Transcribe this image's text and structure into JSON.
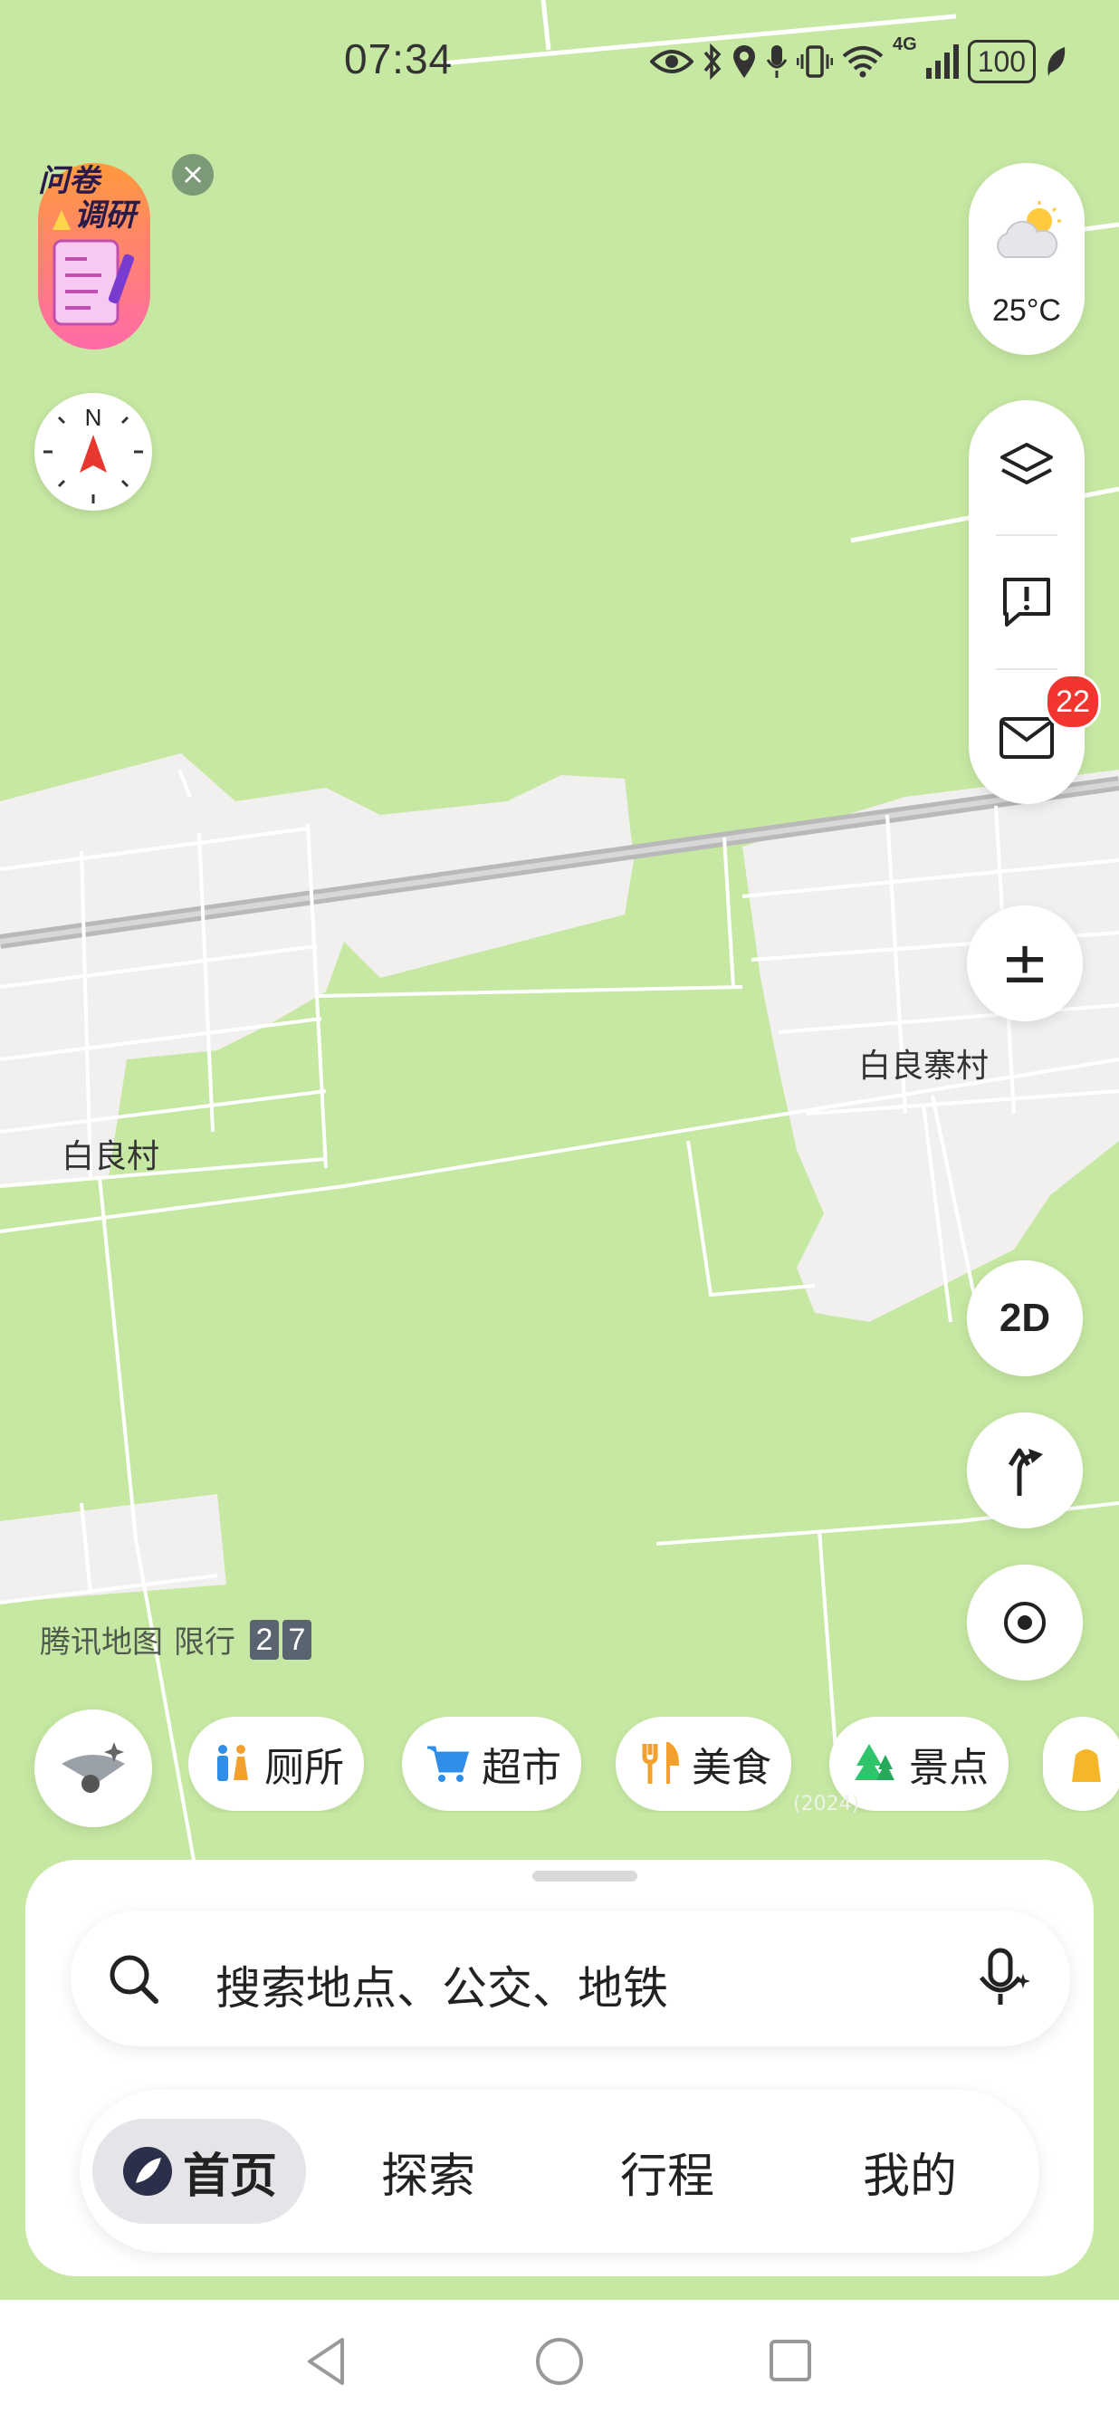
{
  "status": {
    "time": "07:34",
    "network": "4G",
    "battery": "100"
  },
  "weather": {
    "temp": "25°C",
    "icon": "partly-cloudy-icon"
  },
  "compass": {
    "north": "N"
  },
  "message_badge": "22",
  "zoom_label": "±",
  "mode_2d": "2D",
  "map": {
    "labels": {
      "village_a": "白良村",
      "village_b": "白良寨村"
    },
    "watermark": "腾讯地图",
    "restriction_label": "限行",
    "restriction_nums": [
      "2",
      "7"
    ],
    "copyright_year": "(2024)"
  },
  "survey": {
    "line1": "问卷",
    "line2": "调研"
  },
  "chips": [
    {
      "label": "厕所",
      "icon": "toilet-icon"
    },
    {
      "label": "超市",
      "icon": "cart-icon"
    },
    {
      "label": "美食",
      "icon": "fork-knife-icon"
    },
    {
      "label": "景点",
      "icon": "tree-icon"
    }
  ],
  "search": {
    "placeholder": "搜索地点、公交、地铁"
  },
  "nav": {
    "home": "首页",
    "explore": "探索",
    "trip": "行程",
    "mine": "我的"
  },
  "colors": {
    "map_green": "#c7e8a3",
    "urban": "#f1f0ee",
    "road": "#bdbdbd",
    "badge_red": "#f2352f",
    "compass_red": "#e8372f"
  }
}
